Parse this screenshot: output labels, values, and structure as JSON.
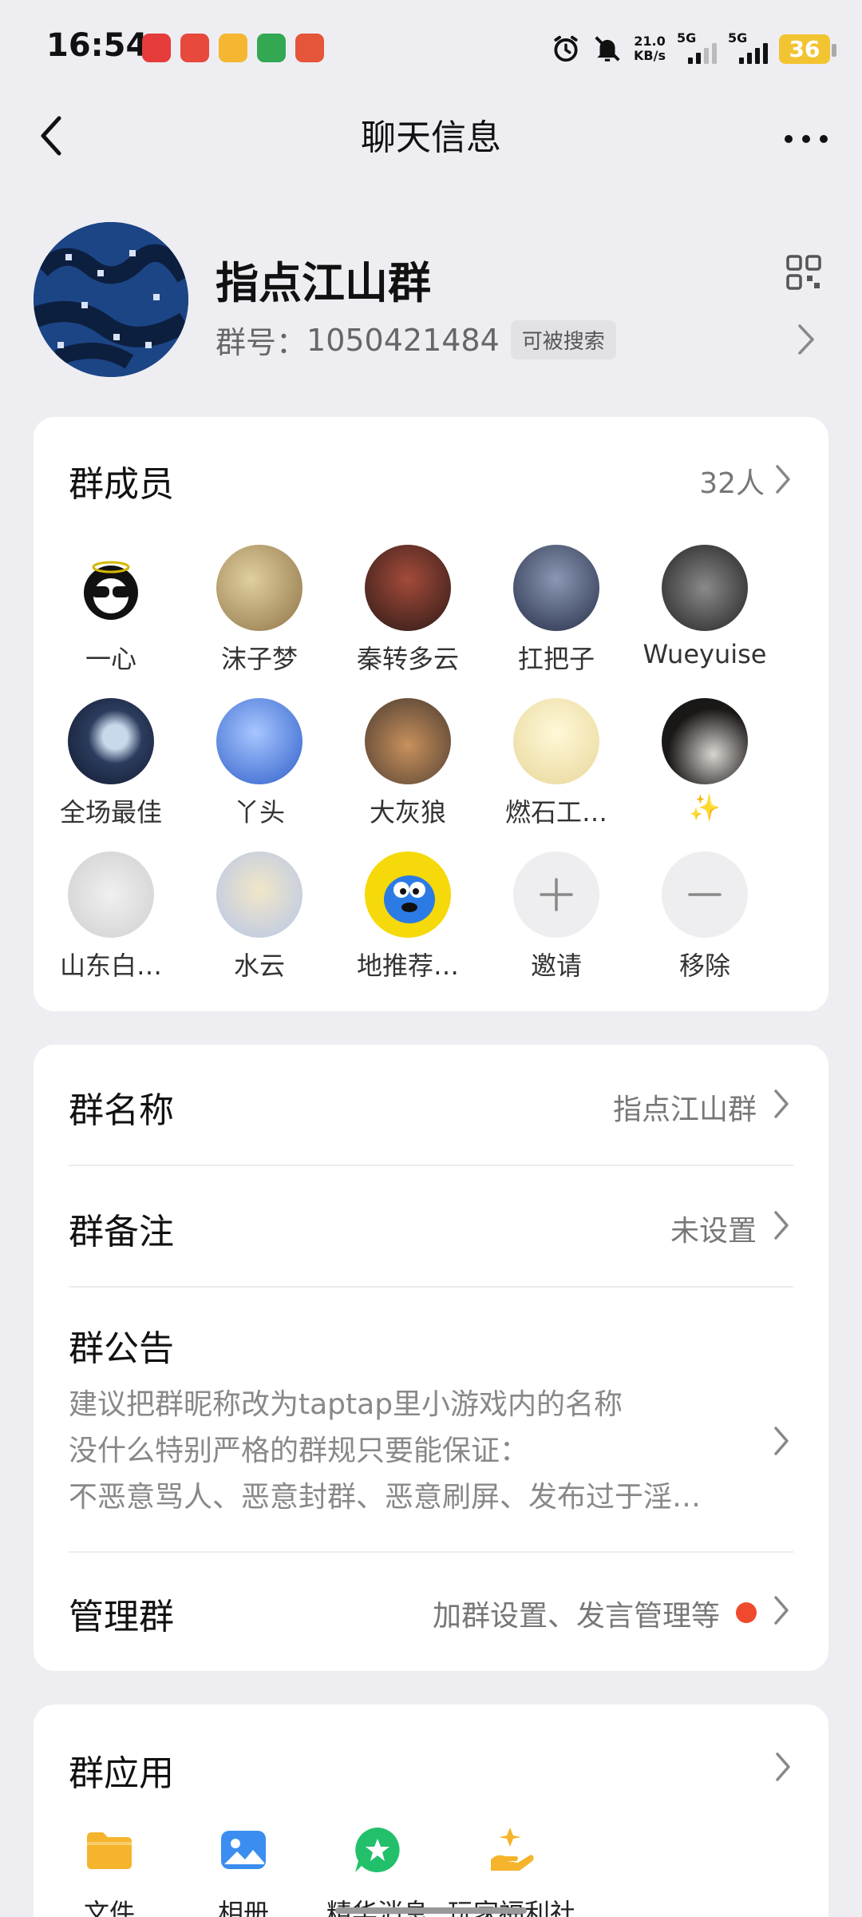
{
  "status_bar": {
    "time": "16:54",
    "net_speed_value": "21.0",
    "net_speed_unit": "KB/s",
    "sim1": "5G",
    "sim2": "5G",
    "battery": "36",
    "app_icon_colors": [
      "#e63b3b",
      "#e8493d",
      "#f5b731",
      "#33a853",
      "#e5553a"
    ]
  },
  "header": {
    "title": "聊天信息",
    "back_icon": "chevron-left-icon",
    "more_icon": "more-dots-icon"
  },
  "group": {
    "name": "指点江山群",
    "id_label": "群号：",
    "id": "1050421484",
    "search_badge": "可被搜索",
    "qr_icon": "qr-code-icon"
  },
  "members": {
    "title": "群成员",
    "count": "32人",
    "list": [
      {
        "name": "一心",
        "color": "#ffffff"
      },
      {
        "name": "沫子梦",
        "color": "#b49a72"
      },
      {
        "name": "秦转多云",
        "color": "#5b3b32"
      },
      {
        "name": "扛把子",
        "color": "#39435a"
      },
      {
        "name": "Wueyuise",
        "color": "#4a4a4a"
      },
      {
        "name": "全场最佳",
        "color": "#1f2b44"
      },
      {
        "name": "丫头",
        "color": "#3d6fd1"
      },
      {
        "name": "大灰狼",
        "color": "#6e5a4a"
      },
      {
        "name": "燃石工…",
        "color": "#f4ecc7"
      },
      {
        "name": "✨",
        "color": "#2a2626"
      },
      {
        "name": "山东白…",
        "color": "#dcdcdc"
      },
      {
        "name": "水云",
        "color": "#c9d6ee"
      },
      {
        "name": "地推荐…",
        "color": "#f5d90a"
      }
    ],
    "invite_label": "邀请",
    "remove_label": "移除"
  },
  "info": {
    "name_label": "群名称",
    "name_value": "指点江山群",
    "remark_label": "群备注",
    "remark_value": "未设置",
    "notice_label": "群公告",
    "notice_lines": [
      "建议把群昵称改为taptap里小游戏内的名称",
      "没什么特别严格的群规只要能保证：",
      "不恶意骂人、恶意封群、恶意刷屏、发布过于淫…"
    ],
    "manage_label": "管理群",
    "manage_value": "加群设置、发言管理等"
  },
  "apps": {
    "title": "群应用",
    "items": [
      {
        "label": "文件",
        "icon": "folder-icon"
      },
      {
        "label": "相册",
        "icon": "photo-album-icon"
      },
      {
        "label": "精华消息",
        "icon": "star-chat-icon"
      },
      {
        "label": "玩家福利社",
        "icon": "gift-hand-icon"
      }
    ]
  },
  "colors": {
    "background": "#eeeef2",
    "card": "#ffffff",
    "badge_red": "#f04a2e",
    "folder": "#f5b42c",
    "album": "#3b8ef0",
    "star": "#23c06c"
  }
}
